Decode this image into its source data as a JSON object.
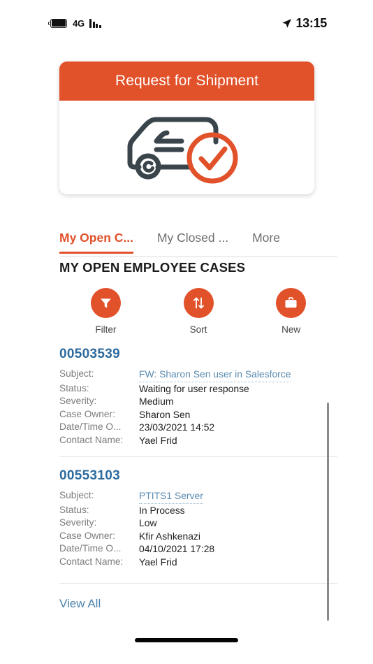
{
  "colors": {
    "accent_orange": "#E1512A",
    "case_number_blue": "#2C6A9E",
    "link_blue": "#5B8BB0",
    "view_all_blue": "#4C83AC",
    "label_gray": "#7C7C7C",
    "van_dark": "#3A444B"
  },
  "status_bar": {
    "network": "4G",
    "time": "13:15",
    "battery_icon": "battery-icon",
    "signal_icon": "signal-bars-icon",
    "location_icon": "location-arrow-icon"
  },
  "hero": {
    "title": "Request for Shipment",
    "illustration": "delivery-van-check-icon"
  },
  "tabs": [
    {
      "label": "My Open C...",
      "active": true
    },
    {
      "label": "My Closed ...",
      "active": false
    },
    {
      "label": "More",
      "active": false
    }
  ],
  "section": {
    "title": "MY OPEN EMPLOYEE CASES"
  },
  "actions": [
    {
      "label": "Filter",
      "icon": "funnel-icon"
    },
    {
      "label": "Sort",
      "icon": "sort-arrows-icon"
    },
    {
      "label": "New",
      "icon": "briefcase-icon"
    }
  ],
  "field_labels": {
    "subject": "Subject:",
    "status": "Status:",
    "severity": "Severity:",
    "case_owner": "Case Owner:",
    "date_time": "Date/Time O...",
    "contact_name": "Contact Name:"
  },
  "cases": [
    {
      "number": "00503539",
      "subject": "FW: Sharon Sen user in Salesforce",
      "status": "Waiting for user response",
      "severity": "Medium",
      "case_owner": "Sharon Sen",
      "date_time": "23/03/2021 14:52",
      "contact_name": "Yael Frid"
    },
    {
      "number": "00553103",
      "subject": "PTITS1 Server",
      "status": "In Process",
      "severity": "Low",
      "case_owner": "Kfir Ashkenazi",
      "date_time": "04/10/2021 17:28",
      "contact_name": "Yael Frid"
    }
  ],
  "footer": {
    "view_all": "View All"
  }
}
